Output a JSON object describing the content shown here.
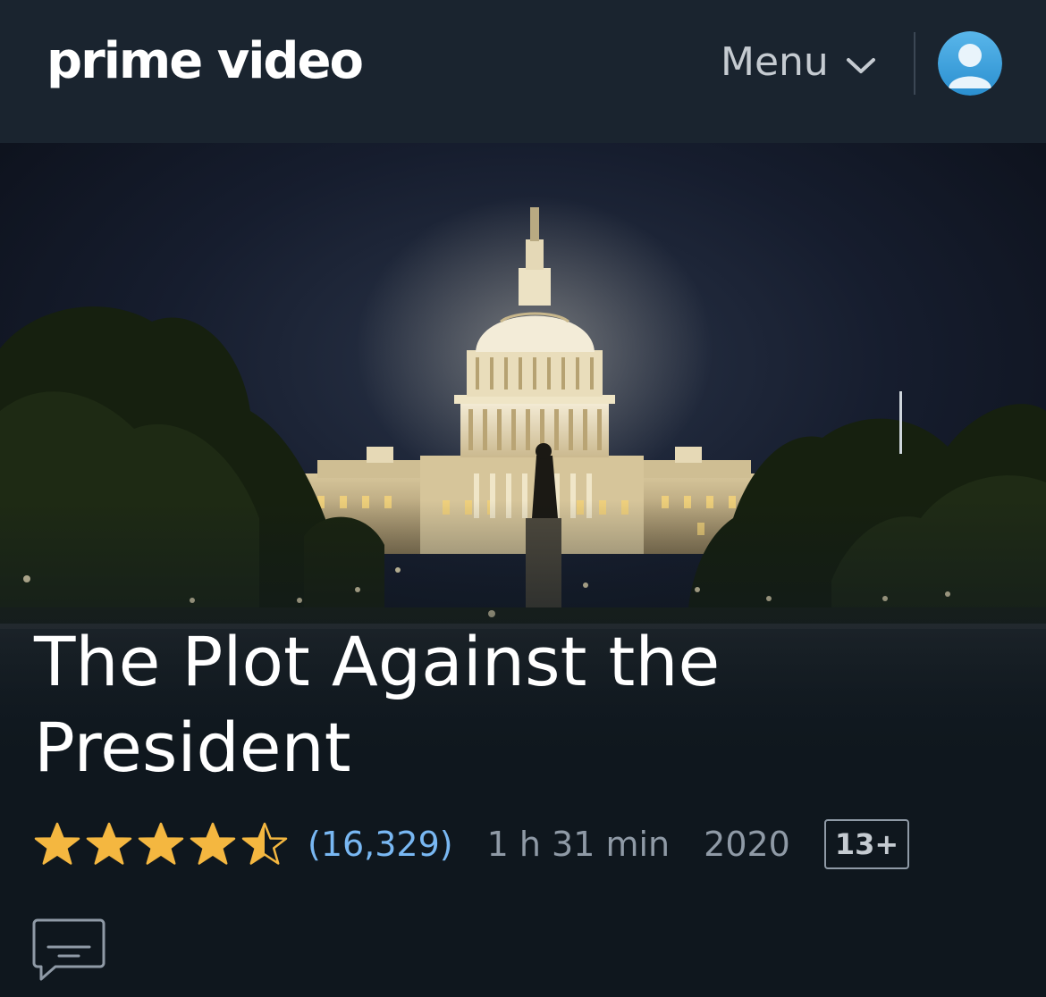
{
  "header": {
    "brand": "prime video",
    "menu_label": "Menu",
    "icons": {
      "menu_chevron": "chevron-down-icon",
      "profile": "user-avatar-icon"
    }
  },
  "hero": {
    "image": "us-capitol-at-night",
    "title": "The Plot Against the President"
  },
  "details": {
    "rating": 4.5,
    "rating_max": 5,
    "review_count": "(16,329)",
    "runtime": "1 h 31 min",
    "year": "2020",
    "maturity_rating": "13+",
    "icons": {
      "subtitles": "subtitles-icon"
    }
  },
  "colors": {
    "header_bg": "#1a242f",
    "page_bg": "#0f171e",
    "star": "#f4b740",
    "link": "#79b8f3",
    "muted": "#8f9aa6"
  }
}
